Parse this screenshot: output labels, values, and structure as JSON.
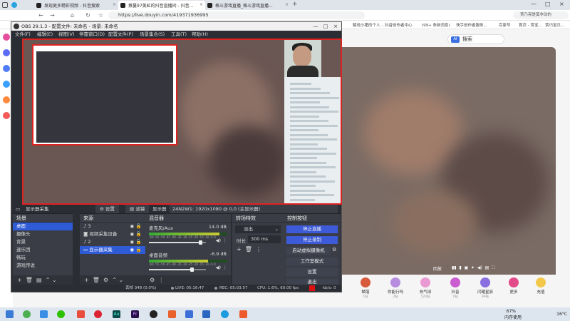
{
  "browser": {
    "tabs": [
      {
        "title": "发现更多精彩视频 - 抖音搜索",
        "active": false
      },
      {
        "title": "蔡蔓97美虹的抖音直播间 - 抖音...",
        "active": true
      },
      {
        "title": "格斗游戏直播_格斗游戏直播...",
        "active": false
      }
    ],
    "url": "https://live.douyin.com/419371936995",
    "bookmarks": [
      "解说小猪的个人...",
      "抖音创作者中心",
      "(99+ 条新消息)",
      "快手创作者服务...",
      "百家号",
      "首页 - 贾宝...",
      "贾巧宝贝..."
    ],
    "search_box": "贾乃亮是莫非动的"
  },
  "douyin": {
    "search_label": "搜索",
    "search_ai": "AI",
    "gifts": [
      {
        "name": "鳞落",
        "price": "1钻"
      },
      {
        "name": "你能行吗",
        "price": "2钻"
      },
      {
        "name": "热气球",
        "price": "520钻"
      },
      {
        "name": "抖音",
        "price": "1钻"
      },
      {
        "name": "闪耀星辰",
        "price": "99钻"
      },
      {
        "name": "更多",
        "price": ""
      },
      {
        "name": "充值",
        "price": ""
      }
    ],
    "player_label": "回放"
  },
  "obs": {
    "title": "OBS 29.1.3 - 配置文件: 未命名 - 场景: 未命名",
    "menu": [
      "文件(F)",
      "编辑(E)",
      "视图(V)",
      "停靠窗口(D)",
      "配置文件(P)",
      "场景集合(S)",
      "工具(T)",
      "帮助(H)"
    ],
    "source_bar": {
      "source": "显示器采集",
      "properties": "设置",
      "filters": "滤镜",
      "display_label": "显示器",
      "display_value": "24N2W1: 1920x1080 @ 0,0 (主显示器)"
    },
    "scenes": {
      "title": "场景",
      "items": [
        "桌面",
        "摄像头",
        "背景",
        "速乐团",
        "畅玩",
        "游戏传说"
      ],
      "selected": 0
    },
    "sources": {
      "title": "来源",
      "items": [
        "3",
        "视频采集设备",
        "2",
        "显示器采集"
      ],
      "selected": 3
    },
    "mixer": {
      "title": "混音器",
      "channels": [
        {
          "name": "麦克风/Aux",
          "db": "14.0 dB",
          "level": 0.9
        },
        {
          "name": "桌面音频",
          "db": "-6.9 dB",
          "level": 0.75
        }
      ],
      "ticks": "-60 -55 -50 -45 -40 -35 -30 -25 -20 -15 -10 -5 0"
    },
    "transitions": {
      "title": "转场特效",
      "type": "淡出",
      "duration_label": "时长",
      "duration": "300 ms"
    },
    "controls": {
      "title": "控制按钮",
      "buttons": [
        "停止直播",
        "停止录制",
        "启动虚拟摄像机",
        "工作室模式",
        "设置",
        "退出"
      ]
    },
    "status": {
      "dropped": "丢帧 348 (0.0%)",
      "live": "LIVE: 05:16:47",
      "rec": "REC: 05:03:57",
      "cpu": "CPU: 1.6%, 60.00 fps",
      "kbs": "kb/s: 0"
    }
  },
  "taskbar": {
    "battery": "67%",
    "memory": "内存使用",
    "temp": "16°C"
  }
}
